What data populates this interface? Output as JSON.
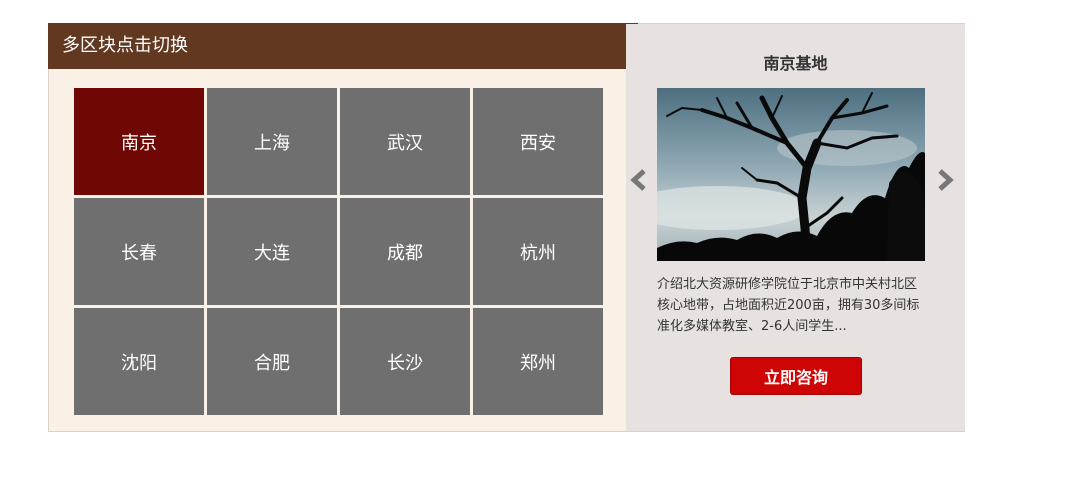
{
  "header": {
    "title": "多区块点击切换"
  },
  "cities": [
    {
      "label": "南京",
      "active": true
    },
    {
      "label": "上海",
      "active": false
    },
    {
      "label": "武汉",
      "active": false
    },
    {
      "label": "西安",
      "active": false
    },
    {
      "label": "长春",
      "active": false
    },
    {
      "label": "大连",
      "active": false
    },
    {
      "label": "成都",
      "active": false
    },
    {
      "label": "杭州",
      "active": false
    },
    {
      "label": "沈阳",
      "active": false
    },
    {
      "label": "合肥",
      "active": false
    },
    {
      "label": "长沙",
      "active": false
    },
    {
      "label": "郑州",
      "active": false
    }
  ],
  "panel": {
    "title": "南京基地",
    "description": "介绍北大资源研修学院位于北京市中关村北区核心地带，占地面积近200亩，拥有30多间标准化多媒体教室、2-6人间学生...",
    "button_label": "立即咨询",
    "prev_icon": "chevron-left-icon",
    "next_icon": "chevron-right-icon"
  },
  "colors": {
    "title_bar": "#633820",
    "active_cell": "#6f0804",
    "cell": "#6f6f6f",
    "button": "#cf0404",
    "panel_bg": "#e7e2e0",
    "widget_bg": "#f9f0e6"
  }
}
